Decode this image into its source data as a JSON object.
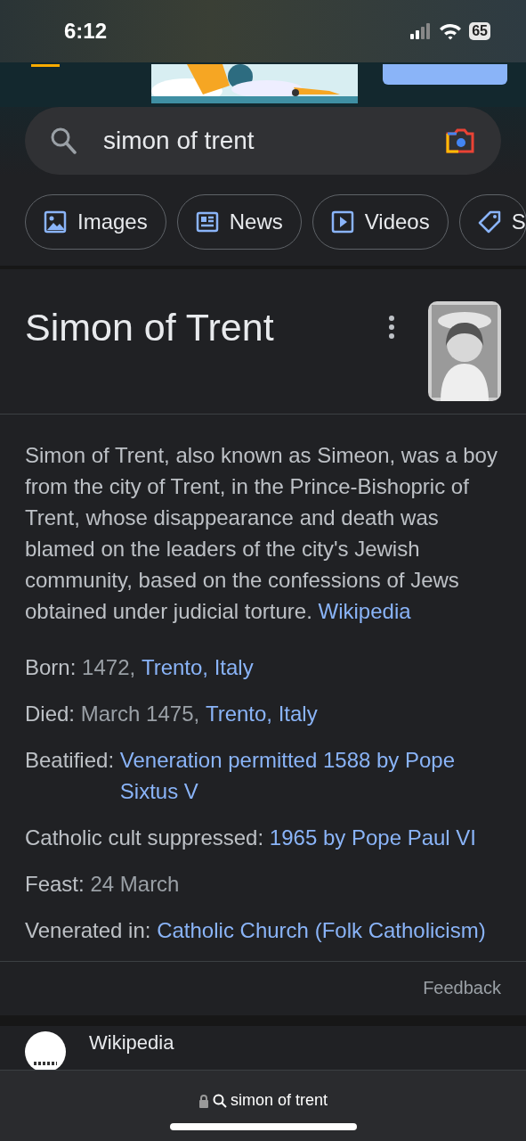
{
  "status_bar": {
    "time": "6:12",
    "battery": "65"
  },
  "search": {
    "query": "simon of trent"
  },
  "chips": [
    {
      "label": "Images",
      "kind": "images"
    },
    {
      "label": "News",
      "kind": "news"
    },
    {
      "label": "Videos",
      "kind": "videos"
    },
    {
      "label": "S",
      "kind": "shopping"
    }
  ],
  "panel": {
    "title": "Simon of Trent",
    "description": {
      "text": "Simon of Trent, also known as Simeon, was a boy from the city of Trent, in the Prince-Bishopric of Trent, whose disappearance and death was blamed on the leaders of the city's Jewish community, based on the confessions of Jews obtained under judicial torture.",
      "link": "Wikipedia"
    },
    "facts": [
      {
        "label": "Born:",
        "parts": [
          {
            "kind": "text",
            "text": "1472,"
          },
          {
            "kind": "link",
            "text": "Trento, Italy"
          }
        ]
      },
      {
        "label": "Died:",
        "parts": [
          {
            "kind": "text",
            "text": "March 1475,"
          },
          {
            "kind": "link",
            "text": "Trento, Italy"
          }
        ]
      },
      {
        "label": "Beatified:",
        "parts": [
          {
            "kind": "link",
            "text": "Veneration permitted 1588 by Pope Sixtus V"
          }
        ]
      },
      {
        "label": "Catholic cult suppressed:",
        "parts": [
          {
            "kind": "link",
            "text": "1965 by Pope Paul VI"
          }
        ]
      },
      {
        "label": "Feast:",
        "parts": [
          {
            "kind": "text",
            "text": "24 March"
          }
        ]
      },
      {
        "label": "Venerated in:",
        "parts": [
          {
            "kind": "link",
            "text": "Catholic Church"
          },
          {
            "kind": "link",
            "text": "(Folk Catholicism)"
          }
        ]
      }
    ],
    "feedback": "Feedback"
  },
  "result": {
    "source": "Wikipedia"
  },
  "address_bar": {
    "text": "simon of trent"
  }
}
